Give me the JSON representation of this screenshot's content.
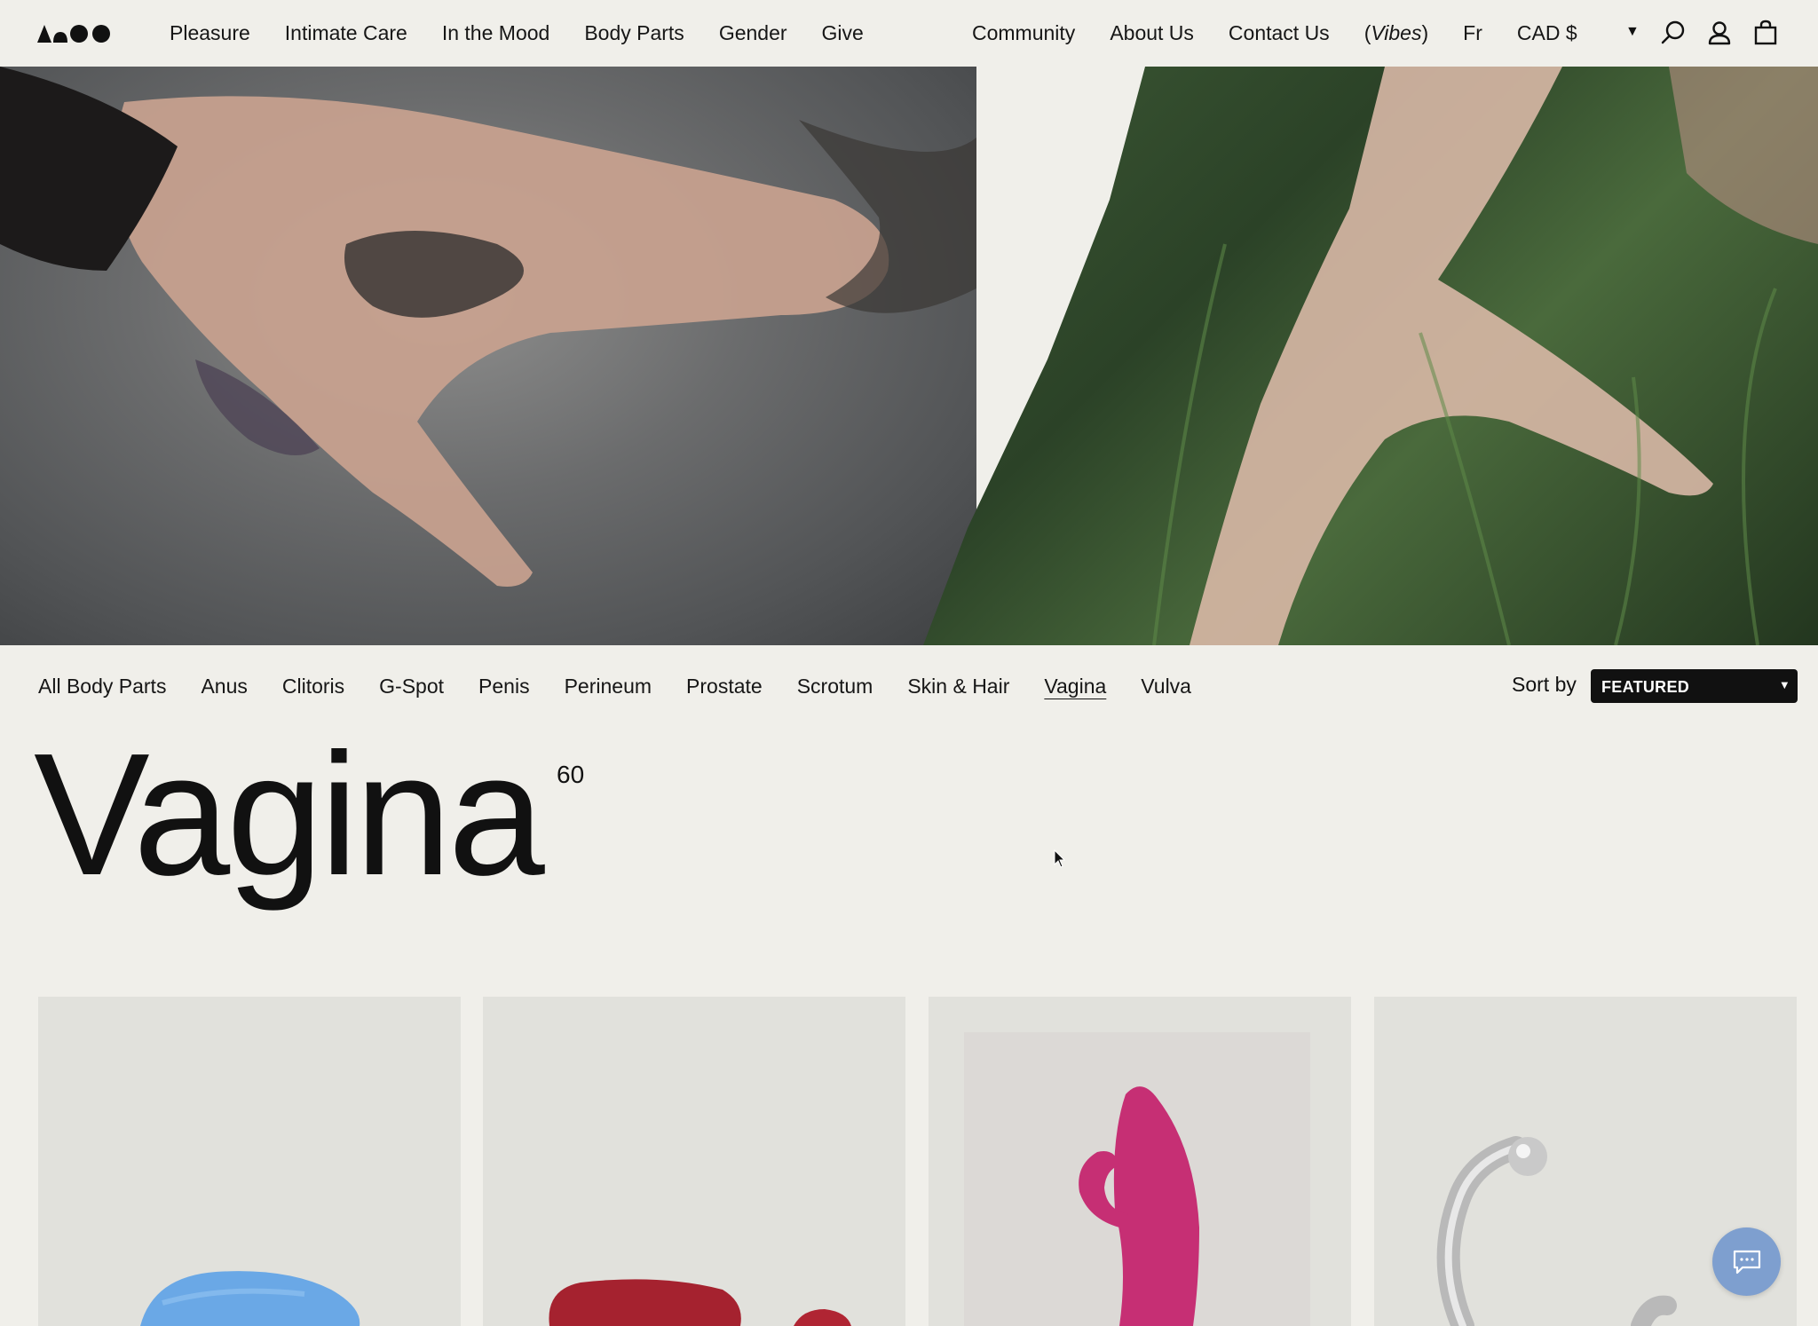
{
  "nav": {
    "left": [
      "Pleasure",
      "Intimate Care",
      "In the Mood",
      "Body Parts",
      "Gender",
      "Give"
    ],
    "right": {
      "community": "Community",
      "about": "About Us",
      "contact": "Contact Us",
      "vibes": "Vibes",
      "language": "Fr",
      "currency": "CAD $"
    },
    "icons": [
      "search-icon",
      "account-icon",
      "cart-icon"
    ]
  },
  "filters": {
    "items": [
      "All Body Parts",
      "Anus",
      "Clitoris",
      "G-Spot",
      "Penis",
      "Perineum",
      "Prostate",
      "Scrotum",
      "Skin & Hair",
      "Vagina",
      "Vulva"
    ],
    "active": "Vagina",
    "sort_label": "Sort by",
    "sort_value": "FEATURED"
  },
  "page": {
    "title": "Vagina",
    "count": "60"
  },
  "colors": {
    "background": "#f0efea",
    "card": "#e1e1dc",
    "chat": "#7e9fcf",
    "select": "#111111"
  }
}
